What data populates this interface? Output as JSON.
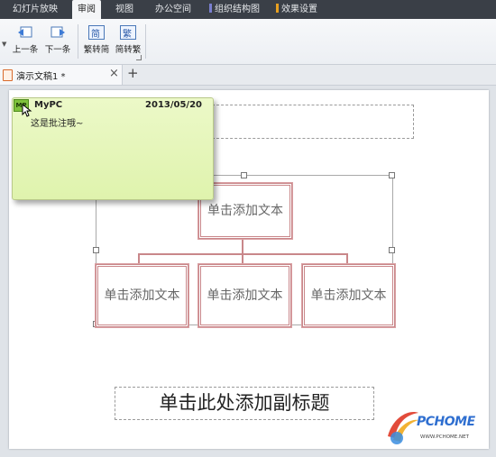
{
  "menubar": {
    "tabs": [
      "幻灯片放映",
      "审阅",
      "视图",
      "办公空间",
      "组织结构图",
      "效果设置"
    ],
    "active_index": 1
  },
  "ribbon": {
    "prev_label": "上一条",
    "next_label": "下一条",
    "to_simplified_label": "繁转简",
    "to_traditional_label": "简转繁",
    "simplified_glyph": "简",
    "traditional_glyph": "繁"
  },
  "doc_tabs": {
    "active_title": "演示文稿1 *",
    "close_glyph": "×",
    "new_glyph": "+"
  },
  "comment": {
    "marker": "MP",
    "author": "MyPC",
    "date": "2013/05/20",
    "text": "这是批注哦~"
  },
  "smartart": {
    "top_node": "单击添加文本",
    "child_nodes": [
      "单击添加文本",
      "单击添加文本",
      "单击添加文本"
    ]
  },
  "subtitle_placeholder": "单击此处添加副标题",
  "watermark": {
    "logo": "PCHOME",
    "url": "WWW.PCHOME.NET"
  },
  "colors": {
    "menubar_bg": "#3a3f47",
    "comment_bg": "#e6f6bb",
    "node_border": "#c9878a",
    "accent_org": "#7a7fd0",
    "accent_effect": "#e8a020"
  }
}
